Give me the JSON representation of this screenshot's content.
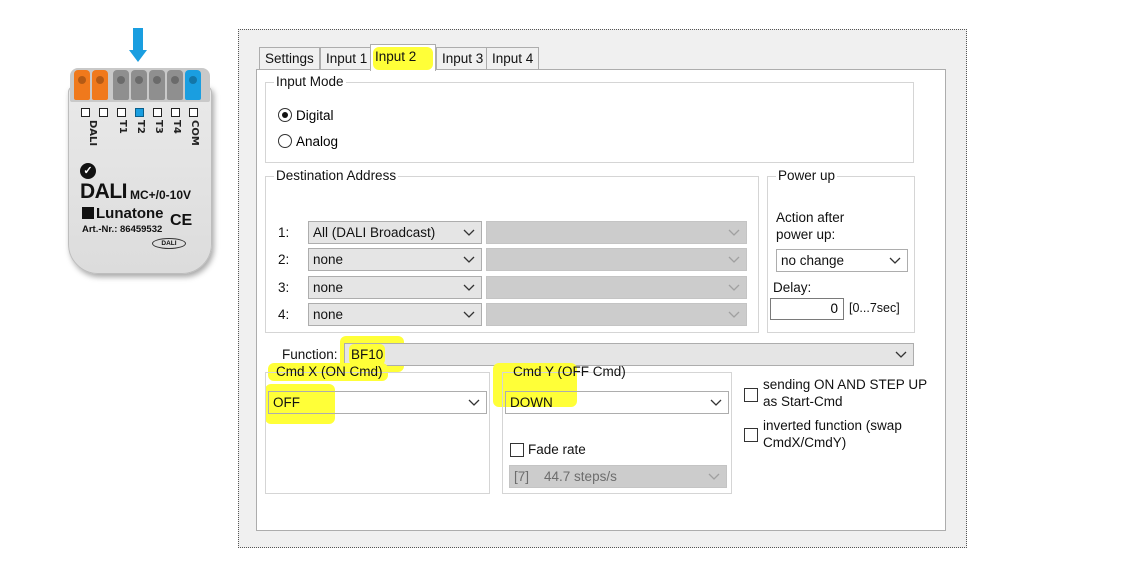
{
  "device": {
    "pins": [
      "DALI",
      "T1",
      "T2",
      "T3",
      "T4",
      "COM"
    ],
    "name": "DALI",
    "model": "MC+/0-10V",
    "brand": "Lunatone",
    "ce": "CE",
    "article": "Art.-Nr.: 86459532",
    "badge": "DALI",
    "colors": {
      "dali_terminal": "#f0791c",
      "input_terminal": "#8f8f8f",
      "com_terminal": "#1a9ee0",
      "active_input": "#1a9ee0"
    }
  },
  "tabs": [
    {
      "label": "Settings",
      "active": false
    },
    {
      "label": "Input 1",
      "active": false
    },
    {
      "label": "Input 2",
      "active": true
    },
    {
      "label": "Input 3",
      "active": false
    },
    {
      "label": "Input 4",
      "active": false
    }
  ],
  "input_mode": {
    "title": "Input Mode",
    "options": [
      {
        "label": "Digital",
        "selected": true
      },
      {
        "label": "Analog",
        "selected": false
      }
    ]
  },
  "destination": {
    "title": "Destination Address",
    "rows": [
      {
        "num": "1:",
        "value": "All (DALI Broadcast)",
        "secondary": ""
      },
      {
        "num": "2:",
        "value": "none",
        "secondary": ""
      },
      {
        "num": "3:",
        "value": "none",
        "secondary": ""
      },
      {
        "num": "4:",
        "value": "none",
        "secondary": ""
      }
    ]
  },
  "power_up": {
    "title": "Power up",
    "action_label_1": "Action after",
    "action_label_2": "power up:",
    "action_value": "no change",
    "delay_label": "Delay:",
    "delay_value": "0",
    "delay_range": "[0...7sec]"
  },
  "function": {
    "label": "Function:",
    "value": "BF10"
  },
  "cmd_x": {
    "title": "Cmd X  (ON Cmd)",
    "value": "OFF"
  },
  "cmd_y": {
    "title": "Cmd Y  (OFF Cmd)",
    "value": "DOWN",
    "fade_label": "Fade rate",
    "fade_checked": false,
    "fade_index": "[7]",
    "fade_value": "44.7 steps/s"
  },
  "options": [
    {
      "line1": "sending ON AND STEP UP",
      "line2": "as Start-Cmd",
      "checked": false
    },
    {
      "line1": "inverted function (swap",
      "line2": "CmdX/CmdY)",
      "checked": false
    }
  ],
  "highlight_color": "#ffff38"
}
